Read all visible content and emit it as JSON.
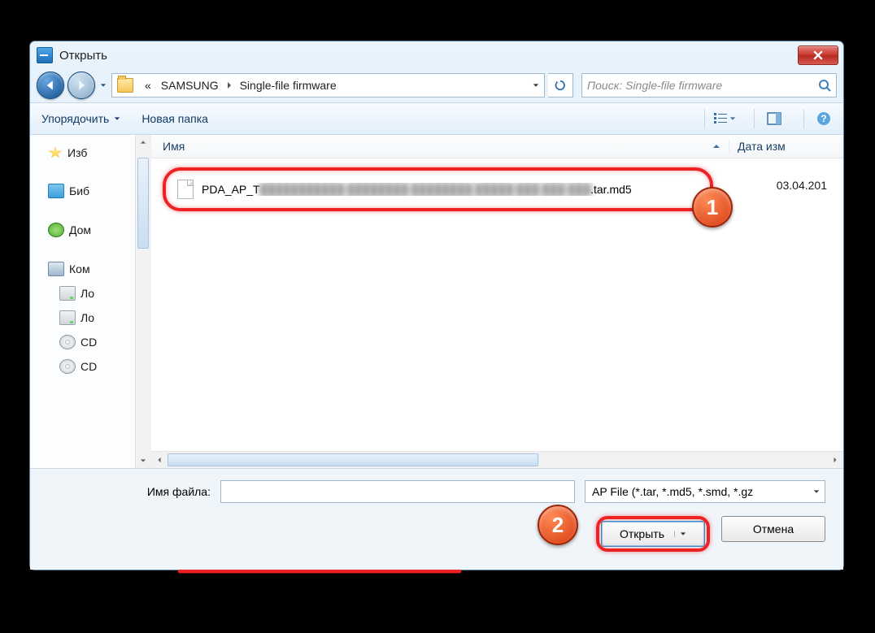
{
  "window": {
    "title": "Открыть"
  },
  "nav": {
    "crumb_prefix": "«",
    "crumb1": "SAMSUNG",
    "crumb2": "Single-file firmware",
    "search_placeholder": "Поиск: Single-file firmware"
  },
  "toolbar": {
    "organize": "Упорядочить",
    "newfolder": "Новая папка"
  },
  "sidebar": {
    "favorites": "Изб",
    "libraries": "Биб",
    "homegroup": "Дом",
    "computer": "Ком",
    "drive1": "Ло",
    "drive2": "Ло",
    "cd1": "CD",
    "cd2": "CD"
  },
  "columns": {
    "name": "Имя",
    "date": "Дата изм"
  },
  "file": {
    "prefix": "PDA_AP_T",
    "blurred": "███████████ ████████ ████████ █████ ███ ███ ███",
    "suffix": ".tar.md5",
    "date": "03.04.201"
  },
  "footer": {
    "filename_label": "Имя файла:",
    "filename_value": "",
    "filetype": "AP File (*.tar, *.md5, *.smd, *.gz",
    "open": "Открыть",
    "cancel": "Отмена"
  },
  "annotations": {
    "badge1": "1",
    "badge2": "2"
  }
}
